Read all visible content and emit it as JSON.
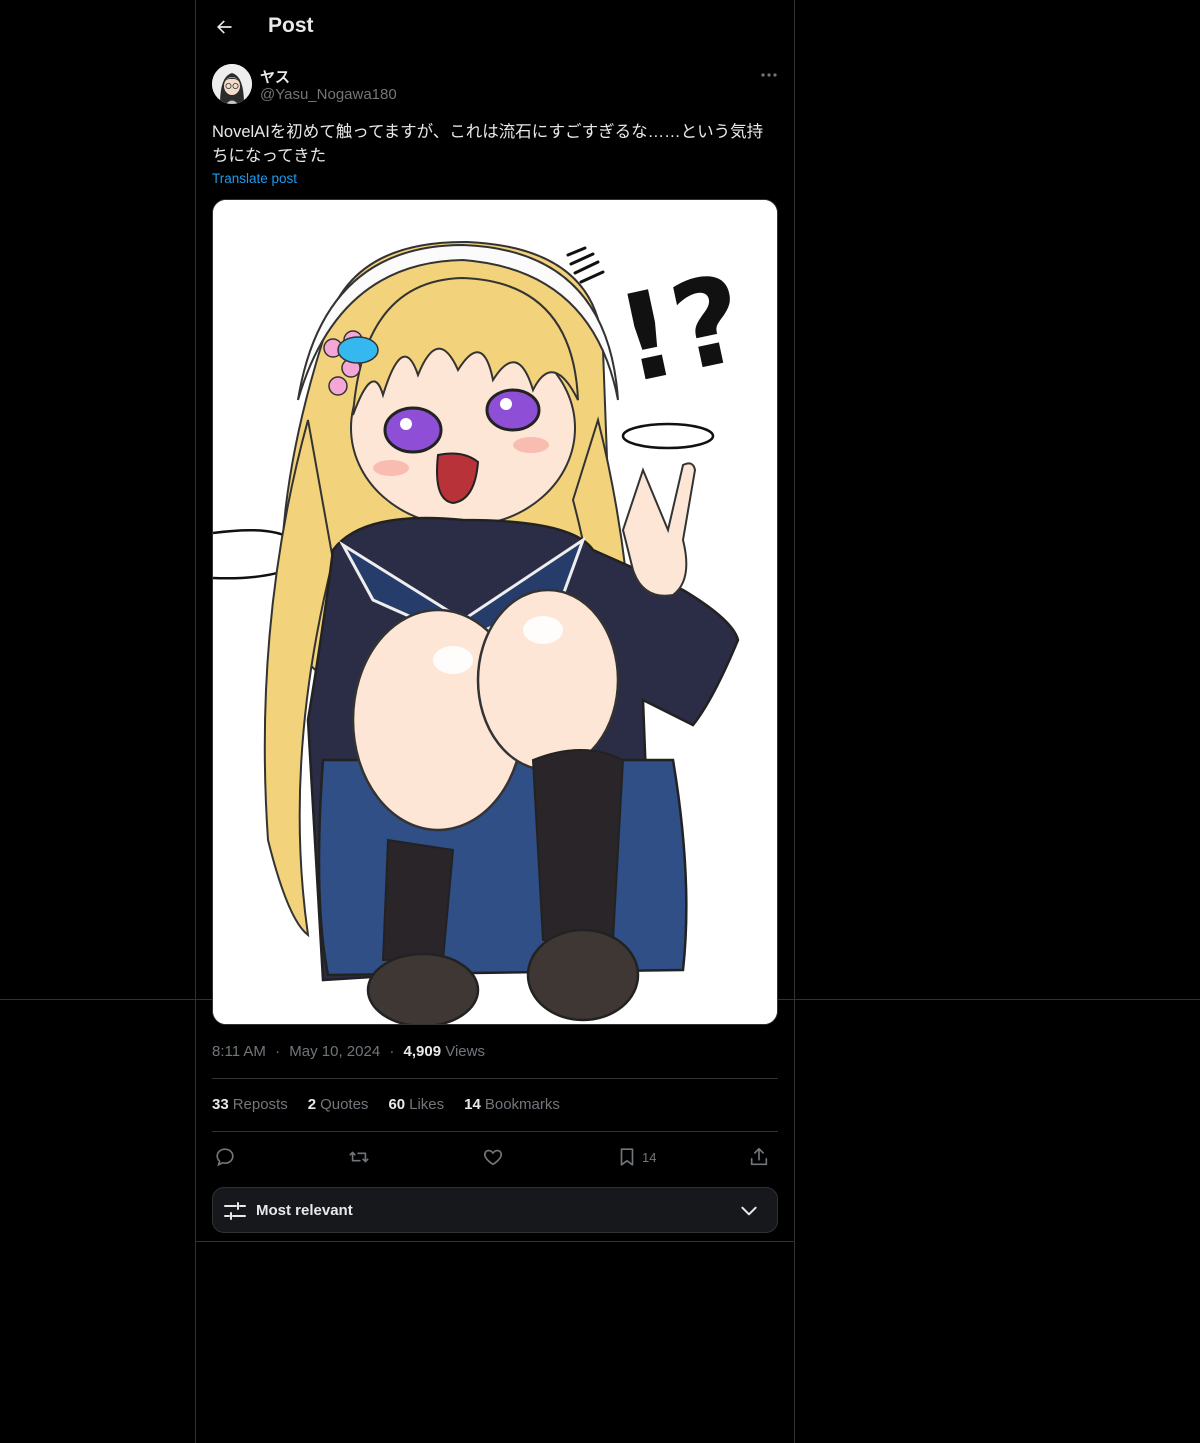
{
  "header": {
    "title": "Post",
    "back_icon": "arrow-left-icon"
  },
  "author": {
    "name": "ヤス",
    "handle": "@Yasu_Nogawa180"
  },
  "post": {
    "text": "NovelAIを初めて触ってますが、これは流石にすごすぎるな……という気持ちになってきた",
    "translate": "Translate post",
    "image_text": "!?"
  },
  "meta": {
    "time": "8:11 AM",
    "sep": "·",
    "date": "May 10, 2024",
    "views_count": "4,909",
    "views_label": "Views"
  },
  "stats": [
    {
      "count": "33",
      "label": "Reposts"
    },
    {
      "count": "2",
      "label": "Quotes"
    },
    {
      "count": "60",
      "label": "Likes"
    },
    {
      "count": "14",
      "label": "Bookmarks"
    }
  ],
  "actions": {
    "bookmark_count": "14"
  },
  "sort": {
    "label": "Most relevant"
  },
  "colors": {
    "background": "#000000",
    "border": "#2f3336",
    "accent": "#1d9bf0",
    "muted": "#71767b",
    "text": "#e7e9ea"
  }
}
